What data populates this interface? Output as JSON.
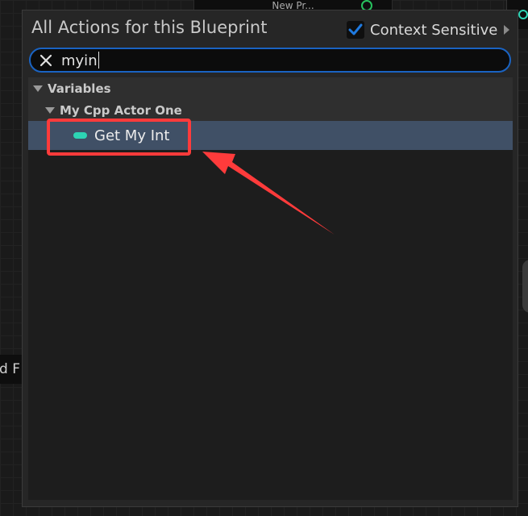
{
  "background": {
    "top_node_label": "New Pr...",
    "left_node_label": "nd F"
  },
  "popup": {
    "title": "All Actions for this Blueprint",
    "context_sensitive": {
      "label": "Context Sensitive",
      "checked": true
    },
    "search": {
      "value": "myin",
      "placeholder": ""
    },
    "tree": {
      "category": "Variables",
      "subcategory": "My Cpp Actor One",
      "items": [
        {
          "label": "Get My Int",
          "type_color": "#2dd4b4",
          "selected": true
        }
      ]
    }
  },
  "colors": {
    "selection": "#405066",
    "search_border": "#1a63c2",
    "annotation": "#ff3b3b",
    "integer_pin": "#2dd4b4",
    "checkbox": "#1f7ae0"
  }
}
